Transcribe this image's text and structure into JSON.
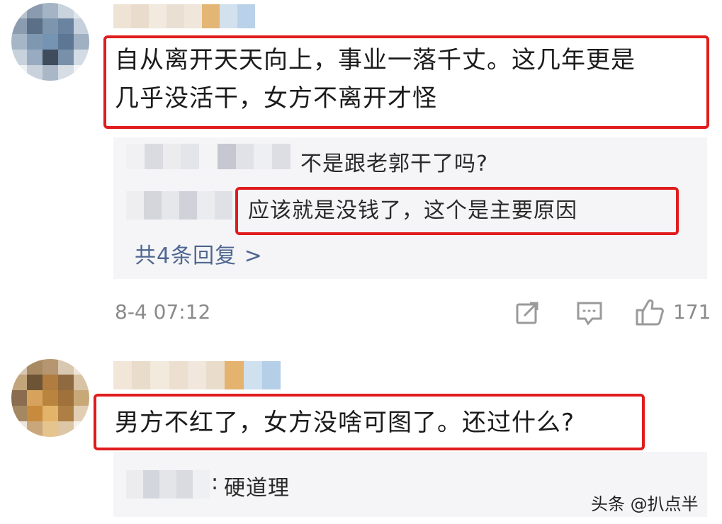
{
  "comments": [
    {
      "text_line1": "自从离开天天向上，事业一落千丈。这几年更是",
      "text_line2": "几乎没活干，女方不离开才怪",
      "replies": [
        {
          "text": "不是跟老郭干了吗?"
        },
        {
          "text": "应该就是没钱了，这个是主要原因"
        }
      ],
      "more_replies": "共4条回复 >",
      "timestamp": "8-4 07:12",
      "like_count": "171"
    },
    {
      "text_line1": "男方不红了，女方没啥可图了。还过什么?",
      "replies": [
        {
          "prefix": ":",
          "text": "硬道理"
        }
      ]
    }
  ],
  "watermark": "头条 @扒点半",
  "icons": {
    "share": "share-icon",
    "comment": "comment-icon",
    "like": "thumbs-up-icon"
  },
  "colors": {
    "highlight_border": "#e01c1c",
    "link": "#4f6790",
    "meta": "#8a8a8a",
    "reply_bg": "#f5f5f7"
  }
}
